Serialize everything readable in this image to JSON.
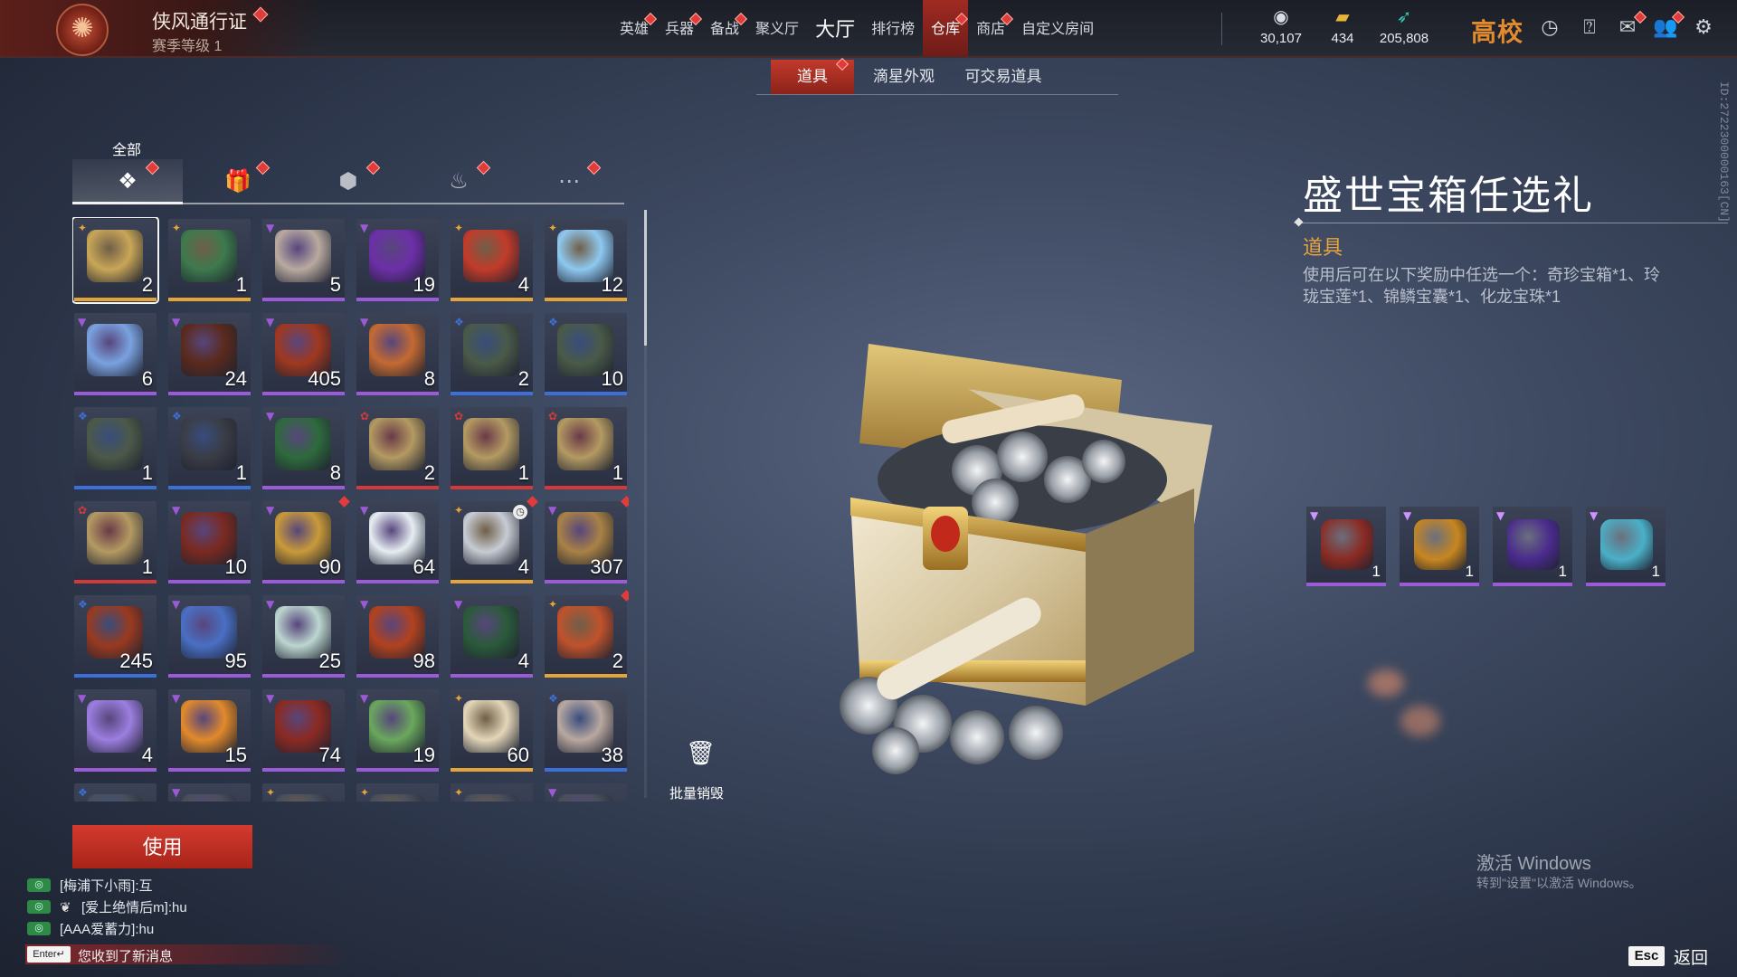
{
  "header": {
    "pass_title": "侠风通行证",
    "pass_level": "赛季等级 1",
    "nav": [
      {
        "label": "英雄",
        "dot": true,
        "big": false,
        "active": false
      },
      {
        "label": "兵器",
        "dot": true,
        "big": false,
        "active": false
      },
      {
        "label": "备战",
        "dot": true,
        "big": false,
        "active": false
      },
      {
        "label": "聚义厅",
        "dot": false,
        "big": false,
        "active": false
      },
      {
        "label": "大厅",
        "dot": false,
        "big": true,
        "active": false
      },
      {
        "label": "排行榜",
        "dot": false,
        "big": false,
        "active": false
      },
      {
        "label": "仓库",
        "dot": true,
        "big": false,
        "active": true
      },
      {
        "label": "商店",
        "dot": true,
        "big": false,
        "active": false
      },
      {
        "label": "自定义房间",
        "dot": false,
        "big": false,
        "active": false
      }
    ],
    "resources": [
      {
        "icon": "coin-icon",
        "value": "30,107",
        "color": "#d9dde4"
      },
      {
        "icon": "gold-ingot-icon",
        "value": "434",
        "color": "#e8b53a"
      },
      {
        "icon": "feather-icon",
        "value": "205,808",
        "color": "#39c2b3"
      }
    ],
    "brand": "高校",
    "icons": [
      "clock-icon",
      "help-icon",
      "mail-icon",
      "friends-icon",
      "settings-icon"
    ]
  },
  "subtabs": [
    {
      "label": "道具",
      "active": true,
      "dot": true
    },
    {
      "label": "滴星外观",
      "active": false,
      "dot": false
    },
    {
      "label": "可交易道具",
      "active": false,
      "dot": false
    }
  ],
  "vertical_id": "ID:2722300000163[CN]",
  "category": {
    "label": "全部",
    "tabs": [
      {
        "icon": "layers-icon",
        "glyph": "❖",
        "active": true
      },
      {
        "icon": "gift-icon",
        "glyph": "🎁",
        "active": false
      },
      {
        "icon": "tag-icon",
        "glyph": "⬢",
        "active": false
      },
      {
        "icon": "flame-icon",
        "glyph": "♨",
        "active": false
      },
      {
        "icon": "more-icon",
        "glyph": "⋯",
        "active": false
      }
    ]
  },
  "rarity_colors": {
    "purple": "#9b5bd6",
    "gold": "#e3a53a",
    "blue": "#3d6fd8",
    "red": "#d1393a"
  },
  "items": [
    {
      "name": "盛世宝箱任选礼",
      "qty": "2",
      "rarity": "gold",
      "art": "#c9a657",
      "selected": true
    },
    {
      "name": "chest-green",
      "qty": "1",
      "rarity": "gold",
      "art": "#3d7a4d"
    },
    {
      "name": "ox-skull",
      "qty": "5",
      "rarity": "purple",
      "art": "#b9aaa0"
    },
    {
      "name": "purple-armor",
      "qty": "19",
      "rarity": "purple",
      "art": "#6d2fa8"
    },
    {
      "name": "red-pouch",
      "qty": "4",
      "rarity": "gold",
      "art": "#c23b2a"
    },
    {
      "name": "crystal",
      "qty": "12",
      "rarity": "gold",
      "art": "#8ec8f0"
    },
    {
      "name": "crystal-ball",
      "qty": "6",
      "rarity": "purple",
      "art": "#7aa2e0"
    },
    {
      "name": "wooden-box",
      "qty": "24",
      "rarity": "purple",
      "art": "#5a2a1c"
    },
    {
      "name": "hammer",
      "qty": "405",
      "rarity": "purple",
      "art": "#a0381f"
    },
    {
      "name": "taiji-plate",
      "qty": "8",
      "rarity": "purple",
      "art": "#c46a32"
    },
    {
      "name": "iron-chest",
      "qty": "2",
      "rarity": "blue",
      "art": "#4a5a48"
    },
    {
      "name": "iron-chest-2",
      "qty": "10",
      "rarity": "blue",
      "art": "#4a5a48"
    },
    {
      "name": "iron-chest-3",
      "qty": "1",
      "rarity": "blue",
      "art": "#4c5948"
    },
    {
      "name": "key",
      "qty": "1",
      "rarity": "blue",
      "art": "#3a3d46"
    },
    {
      "name": "jade-box",
      "qty": "8",
      "rarity": "purple",
      "art": "#2e6a3c"
    },
    {
      "name": "gold-chest",
      "qty": "2",
      "rarity": "red",
      "art": "#b49a62"
    },
    {
      "name": "gold-chest-2",
      "qty": "1",
      "rarity": "red",
      "art": "#b49a62"
    },
    {
      "name": "gold-chest-3",
      "qty": "1",
      "rarity": "red",
      "art": "#b49a62"
    },
    {
      "name": "gold-chest-4",
      "qty": "1",
      "rarity": "red",
      "art": "#b49a62"
    },
    {
      "name": "red-box",
      "qty": "10",
      "rarity": "purple",
      "art": "#7a2a20"
    },
    {
      "name": "gold-coin",
      "qty": "90",
      "rarity": "purple",
      "art": "#c99a3a",
      "dot": true
    },
    {
      "name": "pearl",
      "qty": "64",
      "rarity": "purple",
      "art": "#e6edf2"
    },
    {
      "name": "silver-key",
      "qty": "4",
      "rarity": "gold",
      "art": "#c7ccd4",
      "dot": true,
      "clock": true
    },
    {
      "name": "bronze-coin",
      "qty": "307",
      "rarity": "purple",
      "art": "#a98245",
      "dot": true
    },
    {
      "name": "flame-mask",
      "qty": "245",
      "rarity": "blue",
      "art": "#9a3a1f"
    },
    {
      "name": "blue-coin",
      "qty": "95",
      "rarity": "purple",
      "art": "#4a6fc4"
    },
    {
      "name": "lotus",
      "qty": "25",
      "rarity": "purple",
      "art": "#bcd6cf"
    },
    {
      "name": "fire-scale",
      "qty": "98",
      "rarity": "purple",
      "art": "#b2421f"
    },
    {
      "name": "gift-box",
      "qty": "4",
      "rarity": "purple",
      "art": "#2b5a3a"
    },
    {
      "name": "treasure-pile",
      "qty": "2",
      "rarity": "gold",
      "art": "#c0522c",
      "dot": true
    },
    {
      "name": "staff",
      "qty": "4",
      "rarity": "purple",
      "art": "#9c7ee0"
    },
    {
      "name": "amber",
      "qty": "15",
      "rarity": "purple",
      "art": "#e28a2c"
    },
    {
      "name": "card",
      "qty": "74",
      "rarity": "purple",
      "art": "#8c2a22"
    },
    {
      "name": "jade-slip",
      "qty": "19",
      "rarity": "purple",
      "art": "#6aa85c"
    },
    {
      "name": "scroll",
      "qty": "60",
      "rarity": "gold",
      "art": "#e3d6b8"
    },
    {
      "name": "pouch",
      "qty": "38",
      "rarity": "blue",
      "art": "#b9a8a0"
    },
    {
      "name": "row7-1",
      "qty": "",
      "rarity": "blue",
      "art": "#4a4f5c"
    },
    {
      "name": "row7-2",
      "qty": "",
      "rarity": "purple",
      "art": "#4a4f5c"
    },
    {
      "name": "row7-3",
      "qty": "",
      "rarity": "gold",
      "art": "#4a4f5c"
    },
    {
      "name": "row7-4",
      "qty": "",
      "rarity": "gold",
      "art": "#4a4f5c"
    },
    {
      "name": "row7-5",
      "qty": "",
      "rarity": "gold",
      "art": "#4a4f5c"
    },
    {
      "name": "row7-6",
      "qty": "",
      "rarity": "purple",
      "art": "#4a4f5c"
    }
  ],
  "destroy_label": "批量销毁",
  "use_label": "使用",
  "chat": [
    {
      "text": "[梅浦下小雨]:互",
      "user_icon": false
    },
    {
      "text": "[爱上绝情后m]:hu",
      "user_icon": true
    },
    {
      "text": "[AAA爱蓄力]:hu",
      "user_icon": false
    }
  ],
  "chat_enter": "Enter↵",
  "chat_notice": "您收到了新消息",
  "detail": {
    "title": "盛世宝箱任选礼",
    "type": "道具",
    "desc": "使用后可在以下奖励中任选一个：奇珍宝箱*1、玲珑宝莲*1、锦鳞宝囊*1、化龙宝珠*1",
    "rewards": [
      {
        "name": "奇珍宝箱",
        "qty": "1",
        "art": "#8a2a22"
      },
      {
        "name": "玲珑宝莲",
        "qty": "1",
        "art": "#c8861f"
      },
      {
        "name": "锦鳞宝囊",
        "qty": "1",
        "art": "#4a2a8c"
      },
      {
        "name": "化龙宝珠",
        "qty": "1",
        "art": "#4ab0c8"
      }
    ]
  },
  "watermark": {
    "title": "激活 Windows",
    "sub": "转到\"设置\"以激活 Windows。"
  },
  "esc_key": "Esc",
  "esc_label": "返回"
}
